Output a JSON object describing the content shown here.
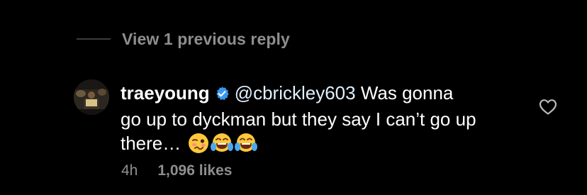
{
  "replies": {
    "view_previous_label": "View 1 previous reply"
  },
  "comment": {
    "username": "traeyoung",
    "verified": true,
    "mention": "@cbrickley603",
    "text_line1": " Was gonna",
    "text_rest": "go up to dyckman but they say I can’t go up there…",
    "emojis": [
      "woozy-face",
      "face-with-tears-of-joy",
      "face-with-tears-of-joy"
    ],
    "time_ago": "4h",
    "likes": "1,096 likes",
    "like_icon": "heart-outline-icon"
  },
  "colors": {
    "background": "#000000",
    "text": "#ffffff",
    "secondary_text": "#8e8e8e",
    "verified_badge": "#3897f0",
    "mention": "#e0f1ff"
  }
}
